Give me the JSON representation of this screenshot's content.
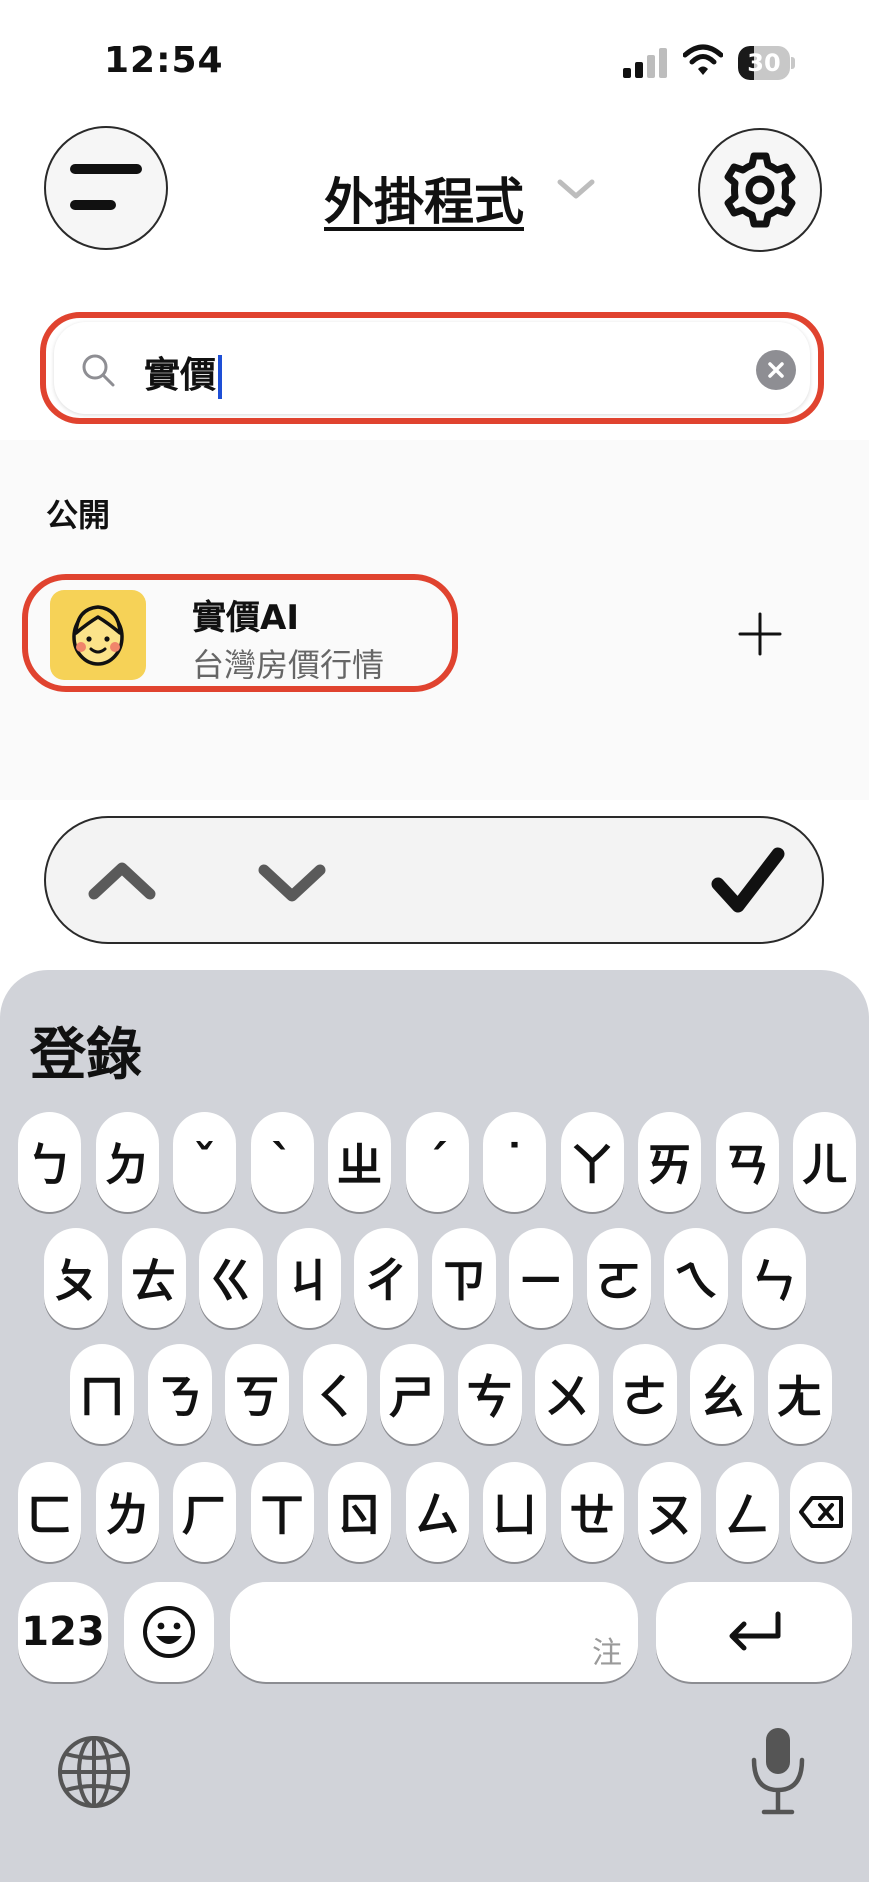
{
  "status_bar": {
    "time": "12:54",
    "battery": "30",
    "battery_level": 0.3
  },
  "header": {
    "title": "外掛程式"
  },
  "search": {
    "value": "實價",
    "placeholder": ""
  },
  "section": {
    "label": "公開"
  },
  "plugin": {
    "name": "實價AI",
    "description": "台灣房價行情"
  },
  "keyboard": {
    "candidate": "登錄",
    "rows": [
      [
        "ㄅ",
        "ㄉ",
        "ˇ",
        "ˋ",
        "ㄓ",
        "ˊ",
        "˙",
        "ㄚ",
        "ㄞ",
        "ㄢ",
        "ㄦ"
      ],
      [
        "ㄆ",
        "ㄊ",
        "ㄍ",
        "ㄐ",
        "ㄔ",
        "ㄗ",
        "ㄧ",
        "ㄛ",
        "ㄟ",
        "ㄣ"
      ],
      [
        "ㄇ",
        "ㄋ",
        "ㄎ",
        "ㄑ",
        "ㄕ",
        "ㄘ",
        "ㄨ",
        "ㄜ",
        "ㄠ",
        "ㄤ"
      ],
      [
        "ㄈ",
        "ㄌ",
        "ㄏ",
        "ㄒ",
        "ㄖ",
        "ㄙ",
        "ㄩ",
        "ㄝ",
        "ㄡ",
        "ㄥ"
      ]
    ],
    "numbers_key": "123",
    "space_hint": "注"
  },
  "colors": {
    "highlight": "#e0432f",
    "keyboard_bg": "#d1d3d9",
    "plugin_icon_bg": "#f6d257"
  },
  "icons": [
    "menu-icon",
    "settings-gear-icon",
    "chevron-down-icon",
    "search-icon",
    "clear-icon",
    "face-icon",
    "plus-icon",
    "up-arrow-icon",
    "down-arrow-icon",
    "checkmark-icon",
    "backspace-icon",
    "emoji-icon",
    "return-icon",
    "globe-icon",
    "microphone-icon"
  ]
}
